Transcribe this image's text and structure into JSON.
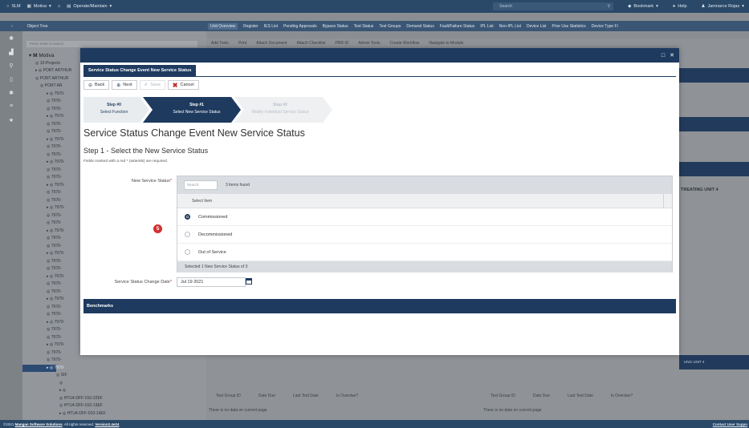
{
  "topbar": {
    "app_name": "SLM",
    "org": "Motiva",
    "module": "Operate/Maintain",
    "search_placeholder": "Search",
    "bookmark": "Bookmark",
    "help": "Help",
    "user": "Jamnarce Rojas"
  },
  "object_tree": {
    "title": "Object Tree",
    "search_placeholder": "Press enter to search",
    "root": "Motiva",
    "nodes": [
      "10-Projects",
      "PORT ARTHUR",
      "PORT ARTHUR",
      "PORT AR",
      "7970-",
      "7970-",
      "7970-",
      "7970-",
      "7970-",
      "7970-",
      "7970-",
      "7970-",
      "7970-",
      "7970-",
      "7970-",
      "7970-",
      "7970-",
      "7970-",
      "7970-",
      "7970-",
      "7970-",
      "7970-",
      "7970-",
      "7970-",
      "7970-",
      "7970-",
      "7970-",
      "7970-",
      "7970-",
      "7970-",
      "7970-",
      "7970-",
      "7970-",
      "7970-",
      "7970-",
      "7970-",
      "7970-",
      "7970-",
      "7970-",
      "7970-",
      "7970-",
      "SIF",
      "",
      "",
      "HTU4-DFF-010-22EF",
      "HTU4-DFF-010-13EF",
      "HTU4-DFF-010-14EF"
    ]
  },
  "tabs": [
    "Unit Overview",
    "Register",
    "IES List",
    "Pending Approvals",
    "Bypass Status",
    "Test Status",
    "Test Groups",
    "Demand Status",
    "Fault/Failure Status",
    "IPL List",
    "Non-IPL List",
    "Device List",
    "Prior Use Statistics",
    "Device Type Fi"
  ],
  "bg_toolbar": [
    "Add Tools",
    "Print",
    "Attach Document",
    "Attach Checklist",
    "PRR ID",
    "Admin Tools",
    "Create Workflow",
    "Navigate to Module"
  ],
  "bg_right_label": "TREATING UNIT 4",
  "bg_bottom_right_header": "UNG UNIT 4",
  "bg_columns": [
    "Test Group ID",
    "Date Due",
    "Last Test Date",
    "Is Overdue?"
  ],
  "bg_nodata": "There is no data on current page",
  "modal": {
    "title": "Service Status Change Event New Service Status",
    "buttons": {
      "back": "Back",
      "next": "Next",
      "save": "Save",
      "cancel": "Cancel"
    },
    "steps": [
      {
        "num": "Step #0",
        "label": "Select Function"
      },
      {
        "num": "Step #1",
        "label": "Select New Service Status"
      },
      {
        "num": "Step #2",
        "label": "Modify Individual Service Status"
      }
    ],
    "heading": "Service Status Change Event New Service Status",
    "subheading": "Step 1 - Select the New Service Status",
    "required_note": "Fields marked with a red * (asterisk) are required.",
    "new_status_label": "New Service Status",
    "search_placeholder": "Search",
    "found_text": "3 items found",
    "column_header": "Select Item",
    "items": [
      {
        "label": "Commissioned",
        "selected": true
      },
      {
        "label": "Decommissioned",
        "selected": false
      },
      {
        "label": "Out of Service",
        "selected": false
      }
    ],
    "selected_text": "Selected 1 New Service Status of 3",
    "badge": "5",
    "date_label": "Service Status Change Date",
    "date_value": "Jul 19 2021",
    "benchmarks": "Benchmarks"
  },
  "footer": {
    "copyright": "©2021",
    "company": "Mangan Software Solutions",
    "rights": ". All rights reserved.",
    "version": "Version2.4e24",
    "contact": "Contact User Suppo"
  }
}
